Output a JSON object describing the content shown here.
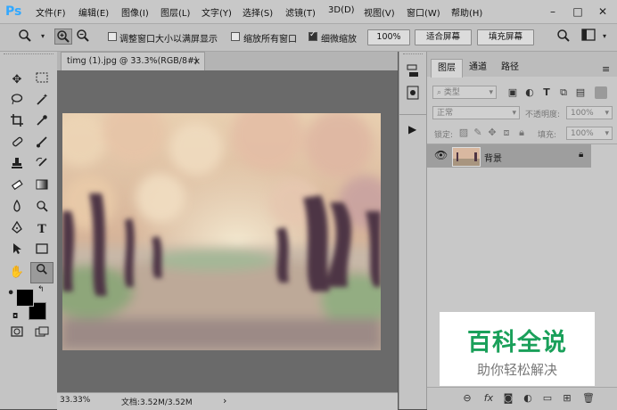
{
  "app": {
    "logo": "Ps",
    "menu": [
      "文件(F)",
      "编辑(E)",
      "图像(I)",
      "图层(L)",
      "文字(Y)",
      "选择(S)",
      "滤镜(T)",
      "3D(D)",
      "视图(V)",
      "窗口(W)",
      "帮助(H)"
    ],
    "window_controls": {
      "minimize": "–",
      "maximize": "□",
      "close": "✕"
    }
  },
  "options": {
    "resize_windows_label": "调整窗口大小以满屏显示",
    "zoom_all_label": "缩放所有窗口",
    "scrubby_zoom_label": "细微缩放",
    "zoom_value": "100%",
    "fit_screen_label": "适合屏幕",
    "fill_screen_label": "填充屏幕",
    "checks": {
      "resize_windows": false,
      "zoom_all": false,
      "scrubby_zoom": true
    }
  },
  "document": {
    "tab_title": "timg (1).jpg @ 33.3%(RGB/8#)",
    "tab_close": "×",
    "status_zoom": "33.33%",
    "status_doc": "文档:3.52M/3.52M",
    "status_arrow": "›"
  },
  "layers": {
    "tabs": [
      "图层",
      "通道",
      "路径"
    ],
    "filter_kind": "类型",
    "blend_mode": "正常",
    "opacity_label": "不透明度:",
    "opacity_value": "100%",
    "lock_label": "锁定:",
    "fill_label": "填充:",
    "fill_value": "100%",
    "items": [
      {
        "name": "背景",
        "visible": true,
        "locked": true
      }
    ]
  },
  "watermark": {
    "title": "百科全说",
    "subtitle": "助你轻松解决"
  },
  "colors": {
    "accent_blue": "#31a8ff",
    "watermark_green": "#1aa05a",
    "panel_bg": "#c8c8c8",
    "canvas_bg": "#6a6a6a"
  }
}
